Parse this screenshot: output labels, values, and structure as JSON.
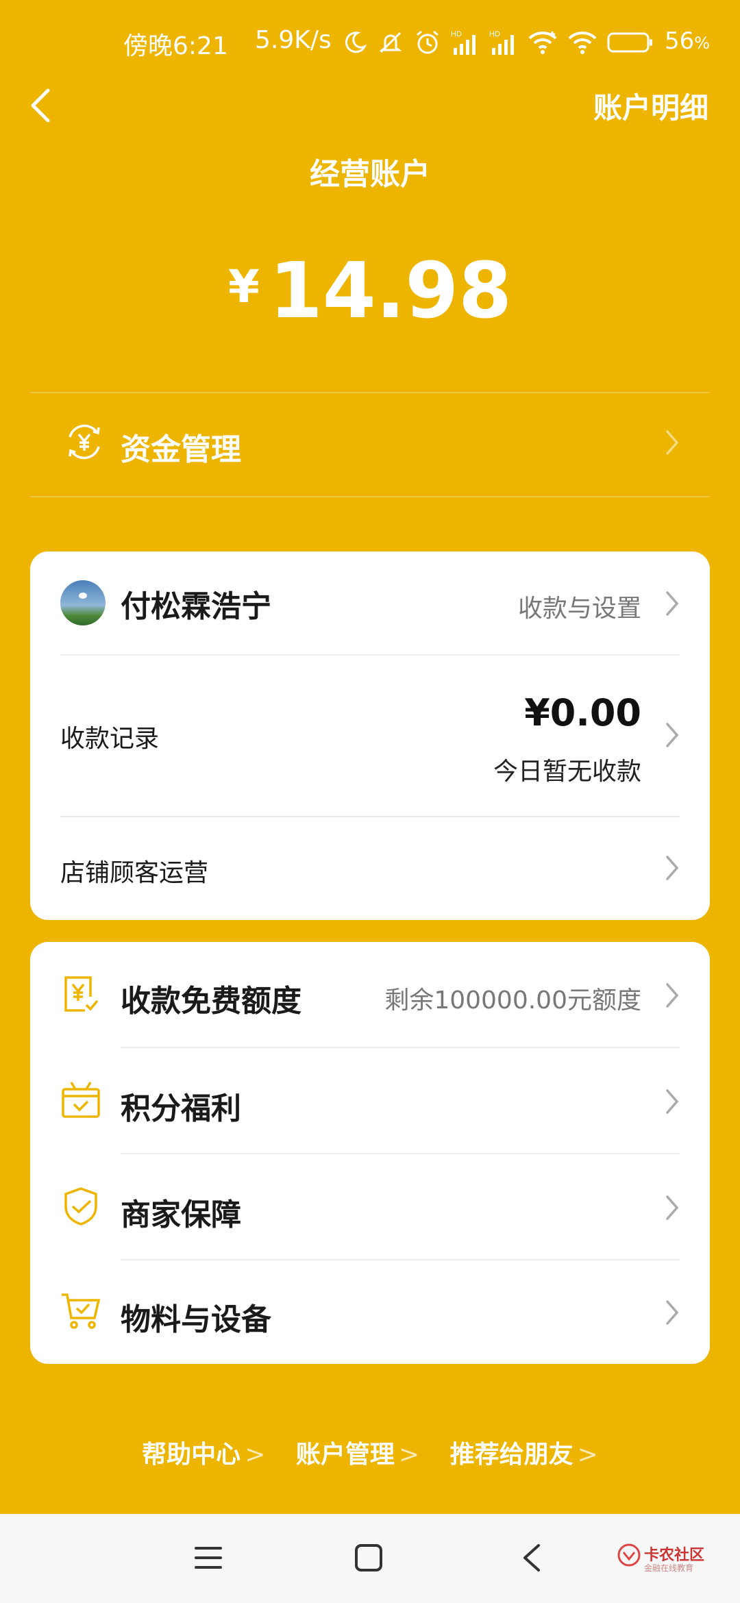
{
  "status_bar": {
    "time": "傍晚6:21",
    "speed": "5.9K/s",
    "battery_percent": "56",
    "battery_unit": "%",
    "icons": [
      "moon-icon",
      "mute-icon",
      "alarm-icon",
      "signal-hd-icon",
      "signal-hd-icon",
      "wifi-icon",
      "hotspot-icon",
      "battery-icon"
    ]
  },
  "header": {
    "back_icon": "back-arrow-icon",
    "detail_link": "账户明细",
    "title": "经营账户"
  },
  "balance": {
    "currency": "¥",
    "amount": "14.98"
  },
  "fund": {
    "icon": "yuan-cycle-icon",
    "label": "资金管理"
  },
  "merchant_card": {
    "name": "付松霖浩宁",
    "settings_link": "收款与设置",
    "records_label": "收款记录",
    "records_amount": "¥0.00",
    "records_sub": "今日暂无收款",
    "operations_label": "店铺顾客运营"
  },
  "services": [
    {
      "icon": "free-quota-icon",
      "label": "收款免费额度",
      "note": "剩余100000.00元额度"
    },
    {
      "icon": "gift-icon",
      "label": "积分福利",
      "note": ""
    },
    {
      "icon": "shield-check-icon",
      "label": "商家保障",
      "note": ""
    },
    {
      "icon": "cart-icon",
      "label": "物料与设备",
      "note": ""
    }
  ],
  "footer_links": [
    "帮助中心",
    "账户管理",
    "推荐给朋友"
  ],
  "footer_chevron": ">",
  "nav_bar": {
    "buttons": [
      "menu-icon",
      "home-square-icon",
      "back-triangle-icon"
    ],
    "watermark_title": "卡农社区",
    "watermark_sub": "金融在线教育"
  },
  "colors": {
    "background": "#EDB500",
    "card": "#FFFFFF",
    "icon_accent": "#EDB500"
  }
}
